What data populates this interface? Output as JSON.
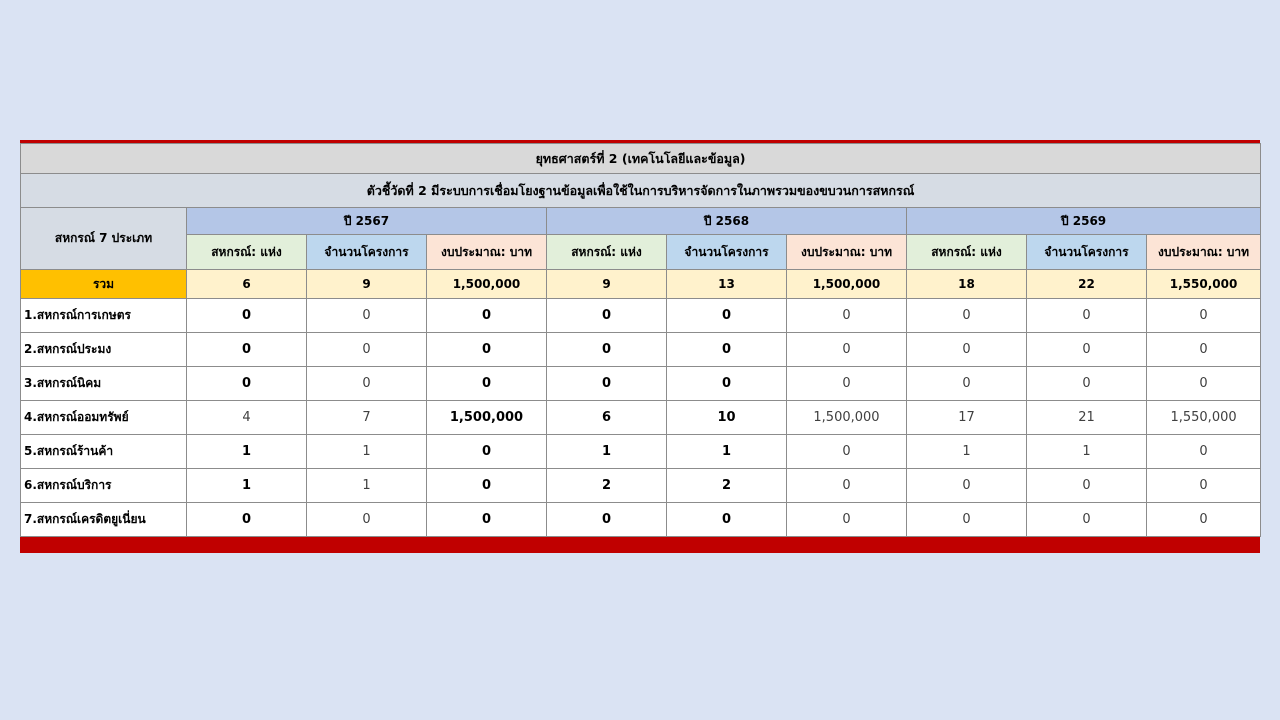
{
  "title": "ยุทธศาสตร์ที่ 2  (เทคโนโลยีและข้อมูล)",
  "indicator": "ตัวชี้วัดที่ 2 มีระบบการเชื่อมโยงฐานข้อมูลเพื่อใช้ในการบริหารจัดการในภาพรวมของขบวนการสหกรณ์",
  "category_header": "สหกรณ์ 7 ประเภท",
  "years": [
    "ปี 2567",
    "ปี 2568",
    "ปี 2569"
  ],
  "subheaders": [
    "สหกรณ์: แห่ง",
    "จำนวนโครงการ",
    "งบประมาณ: บาท"
  ],
  "total": {
    "label": "รวม",
    "values": [
      "6",
      "9",
      "1,500,000",
      "9",
      "13",
      "1,500,000",
      "18",
      "22",
      "1,550,000"
    ]
  },
  "rows": [
    {
      "label": "1.สหกรณ์การเกษตร",
      "values": [
        "0",
        "0",
        "0",
        "0",
        "0",
        "0",
        "0",
        "0",
        "0"
      ]
    },
    {
      "label": "2.สหกรณ์ประมง",
      "values": [
        "0",
        "0",
        "0",
        "0",
        "0",
        "0",
        "0",
        "0",
        "0"
      ]
    },
    {
      "label": "3.สหกรณ์นิคม",
      "values": [
        "0",
        "0",
        "0",
        "0",
        "0",
        "0",
        "0",
        "0",
        "0"
      ]
    },
    {
      "label": "4.สหกรณ์ออมทรัพย์",
      "values": [
        "4",
        "7",
        "1,500,000",
        "6",
        "10",
        "1,500,000",
        "17",
        "21",
        "1,550,000"
      ]
    },
    {
      "label": "5.สหกรณ์ร้านค้า",
      "values": [
        "1",
        "1",
        "0",
        "1",
        "1",
        "0",
        "1",
        "1",
        "0"
      ]
    },
    {
      "label": "6.สหกรณ์บริการ",
      "values": [
        "1",
        "1",
        "0",
        "2",
        "2",
        "0",
        "0",
        "0",
        "0"
      ]
    },
    {
      "label": "7.สหกรณ์เครดิตยูเนี่ยน",
      "values": [
        "0",
        "0",
        "0",
        "0",
        "0",
        "0",
        "0",
        "0",
        "0"
      ]
    }
  ],
  "colors": {
    "background": "#dae3f3",
    "accent_red": "#c00000",
    "total_label": "#ffc000",
    "total_row": "#fff2cc",
    "year_header": "#b4c6e7"
  }
}
